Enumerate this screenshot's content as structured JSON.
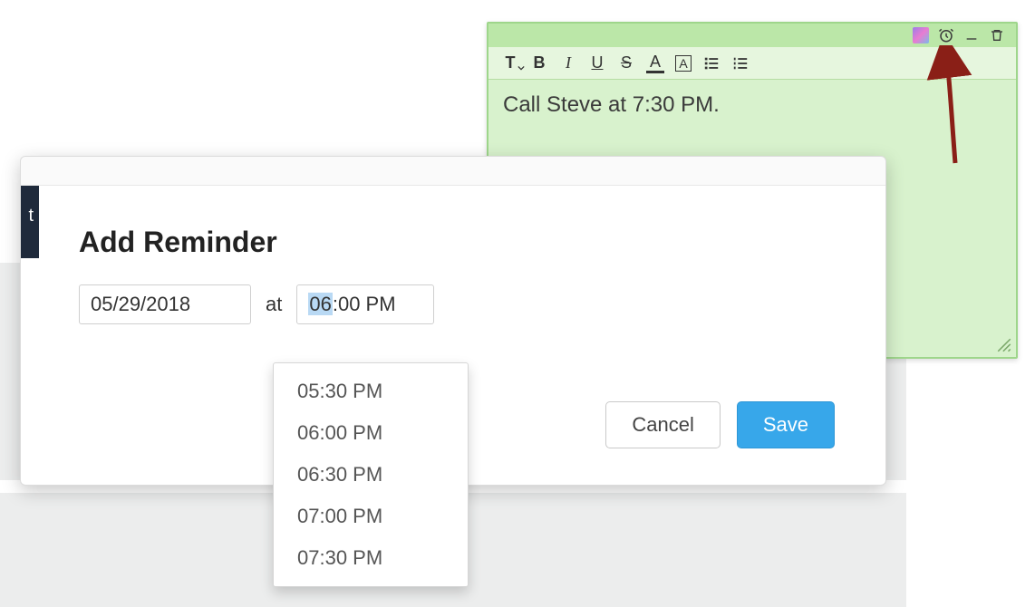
{
  "sticky": {
    "body_text": "Call Steve at 7:30 PM.",
    "toolbar": {
      "text_style_label": "T",
      "bold_label": "B",
      "italic_label": "I",
      "underline_label": "U",
      "strike_label": "S",
      "font_color_label": "A",
      "highlight_label": "A"
    }
  },
  "modal": {
    "title": "Add Reminder",
    "dark_letter": "t",
    "date_value": "05/29/2018",
    "at_label": "at",
    "time_value_sel": "06",
    "time_value_rest": ":00 PM",
    "time_options": [
      "05:30 PM",
      "06:00 PM",
      "06:30 PM",
      "07:00 PM",
      "07:30 PM"
    ],
    "cancel_label": "Cancel",
    "save_label": "Save"
  },
  "colors": {
    "accent": "#37a7ea",
    "note_bg": "#d8f2cd",
    "note_border": "#9ed68b"
  }
}
